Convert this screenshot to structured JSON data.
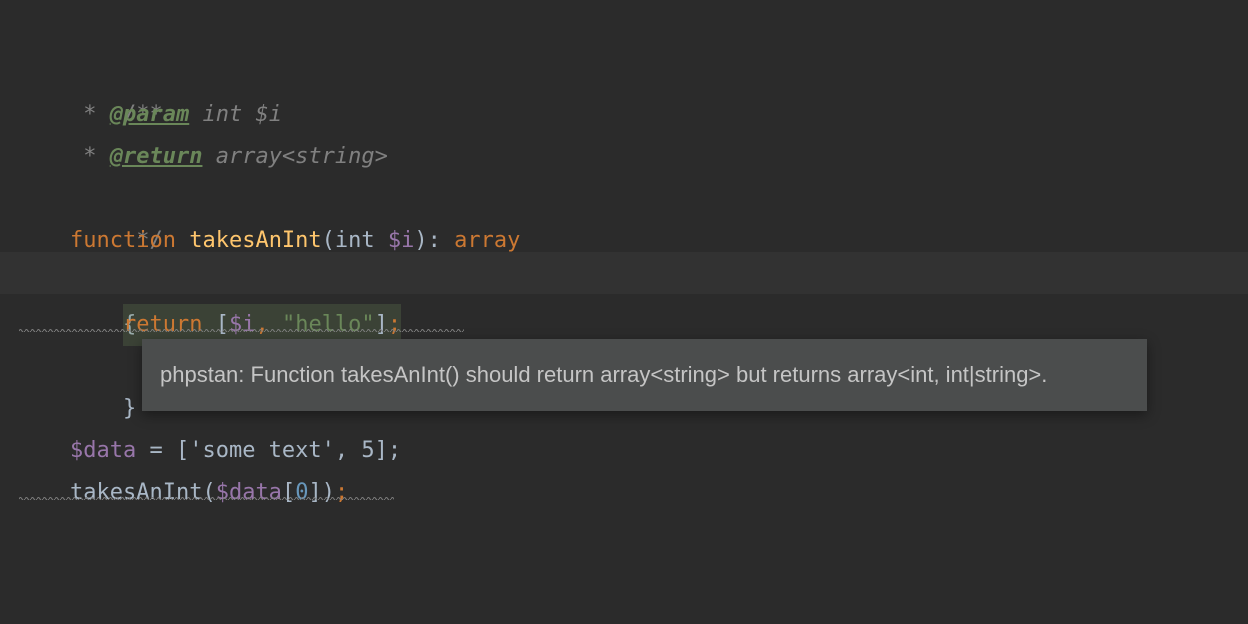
{
  "code": {
    "line1": "/**",
    "line2_star": " * ",
    "line2_tag": "@param",
    "line2_type": " int ",
    "line2_var": "$i",
    "line3_star": " * ",
    "line3_tag": "@return",
    "line3_type": " array<string>",
    "line4": " */",
    "line5_keyword": "function ",
    "line5_name": "takesAnInt",
    "line5_paren_open": "(",
    "line5_param_type": "int ",
    "line5_param_var": "$i",
    "line5_paren_close": ")",
    "line5_colon": ": ",
    "line5_return_type": "array",
    "line6": "{",
    "line7_indent": "    ",
    "line7_return": "return ",
    "line7_bracket_open": "[",
    "line7_var": "$i",
    "line7_comma": ", ",
    "line7_string": "\"hello\"",
    "line7_bracket_close": "]",
    "line7_semi": ";",
    "line8": "}",
    "line9": "",
    "line10_var": "$data",
    "line10_rest": " = ['some text', 5];",
    "line11_func": "takesAnInt",
    "line11_paren_open": "(",
    "line11_var": "$data",
    "line11_bracket_open": "[",
    "line11_index": "0",
    "line11_bracket_close": "]",
    "line11_paren_close": ")",
    "line11_semi": ";"
  },
  "tooltip": {
    "message": "phpstan: Function takesAnInt() should return array<string> but returns array<int, int|string>."
  }
}
